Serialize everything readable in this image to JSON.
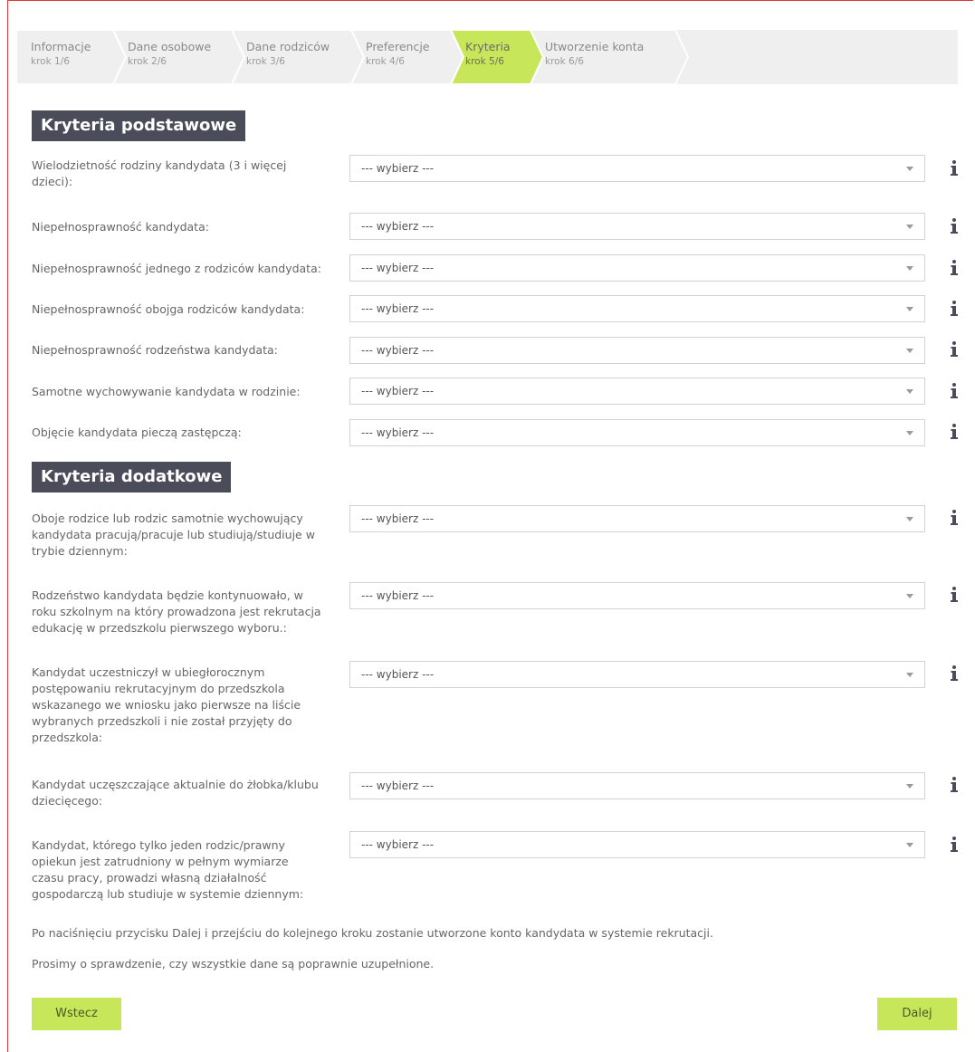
{
  "stepper": {
    "steps": [
      {
        "title": "Informacje",
        "sub": "krok 1/6"
      },
      {
        "title": "Dane osobowe",
        "sub": "krok 2/6"
      },
      {
        "title": "Dane rodziców",
        "sub": "krok 3/6"
      },
      {
        "title": "Preferencje",
        "sub": "krok 4/6"
      },
      {
        "title": "Kryteria",
        "sub": "krok 5/6"
      },
      {
        "title": "Utworzenie konta",
        "sub": "krok 6/6"
      }
    ],
    "active_index": 4,
    "active_color": "#c8e65a",
    "inactive_color": "#efefef"
  },
  "basic": {
    "title": "Kryteria podstawowe",
    "rows": [
      {
        "label": "Wielodzietność rodziny kandydata (3 i więcej dzieci):",
        "value": "--- wybierz ---"
      },
      {
        "label": "Niepełnosprawność kandydata:",
        "value": "--- wybierz ---"
      },
      {
        "label": "Niepełnosprawność jednego z rodziców kandydata:",
        "value": "--- wybierz ---"
      },
      {
        "label": "Niepełnosprawność obojga rodziców kandydata:",
        "value": "--- wybierz ---"
      },
      {
        "label": "Niepełnosprawność rodzeństwa kandydata:",
        "value": "--- wybierz ---"
      },
      {
        "label": "Samotne wychowywanie kandydata w rodzinie:",
        "value": "--- wybierz ---"
      },
      {
        "label": "Objęcie kandydata pieczą zastępczą:",
        "value": "--- wybierz ---"
      }
    ]
  },
  "additional": {
    "title": "Kryteria dodatkowe",
    "rows": [
      {
        "label": "Oboje rodzice lub rodzic samotnie wychowujący kandydata pracują/pracuje lub studiują/studiuje w trybie dziennym:",
        "value": "--- wybierz ---"
      },
      {
        "label": "Rodzeństwo kandydata będzie kontynuowało, w roku szkolnym na który prowadzona jest rekrutacja edukację w przedszkolu pierwszego wyboru.:",
        "value": "--- wybierz ---"
      },
      {
        "label": "Kandydat uczestniczył w ubiegłorocznym postępowaniu rekrutacyjnym do przedszkola wskazanego we wniosku jako pierwsze na liście wybranych przedszkoli i nie został przyjęty do przedszkola:",
        "value": "--- wybierz ---"
      },
      {
        "label": "Kandydat uczęszczające aktualnie do żłobka/klubu dziecięcego:",
        "value": "--- wybierz ---"
      },
      {
        "label": "Kandydat, którego tylko jeden rodzic/prawny opiekun jest zatrudniony w pełnym wymiarze czasu pracy, prowadzi własną działalność gospodarczą lub studiuje w systemie dziennym:",
        "value": "--- wybierz ---"
      }
    ]
  },
  "notes": {
    "line1": "Po naciśnięciu przycisku Dalej i przejściu do kolejnego kroku zostanie utworzone konto kandydata w systemie rekrutacji.",
    "line2": "Prosimy o sprawdzenie, czy wszystkie dane są poprawnie uzupełnione."
  },
  "buttons": {
    "back": "Wstecz",
    "next": "Dalej"
  },
  "icons": {
    "info": "info-icon",
    "caret": "chevron-down-icon"
  }
}
